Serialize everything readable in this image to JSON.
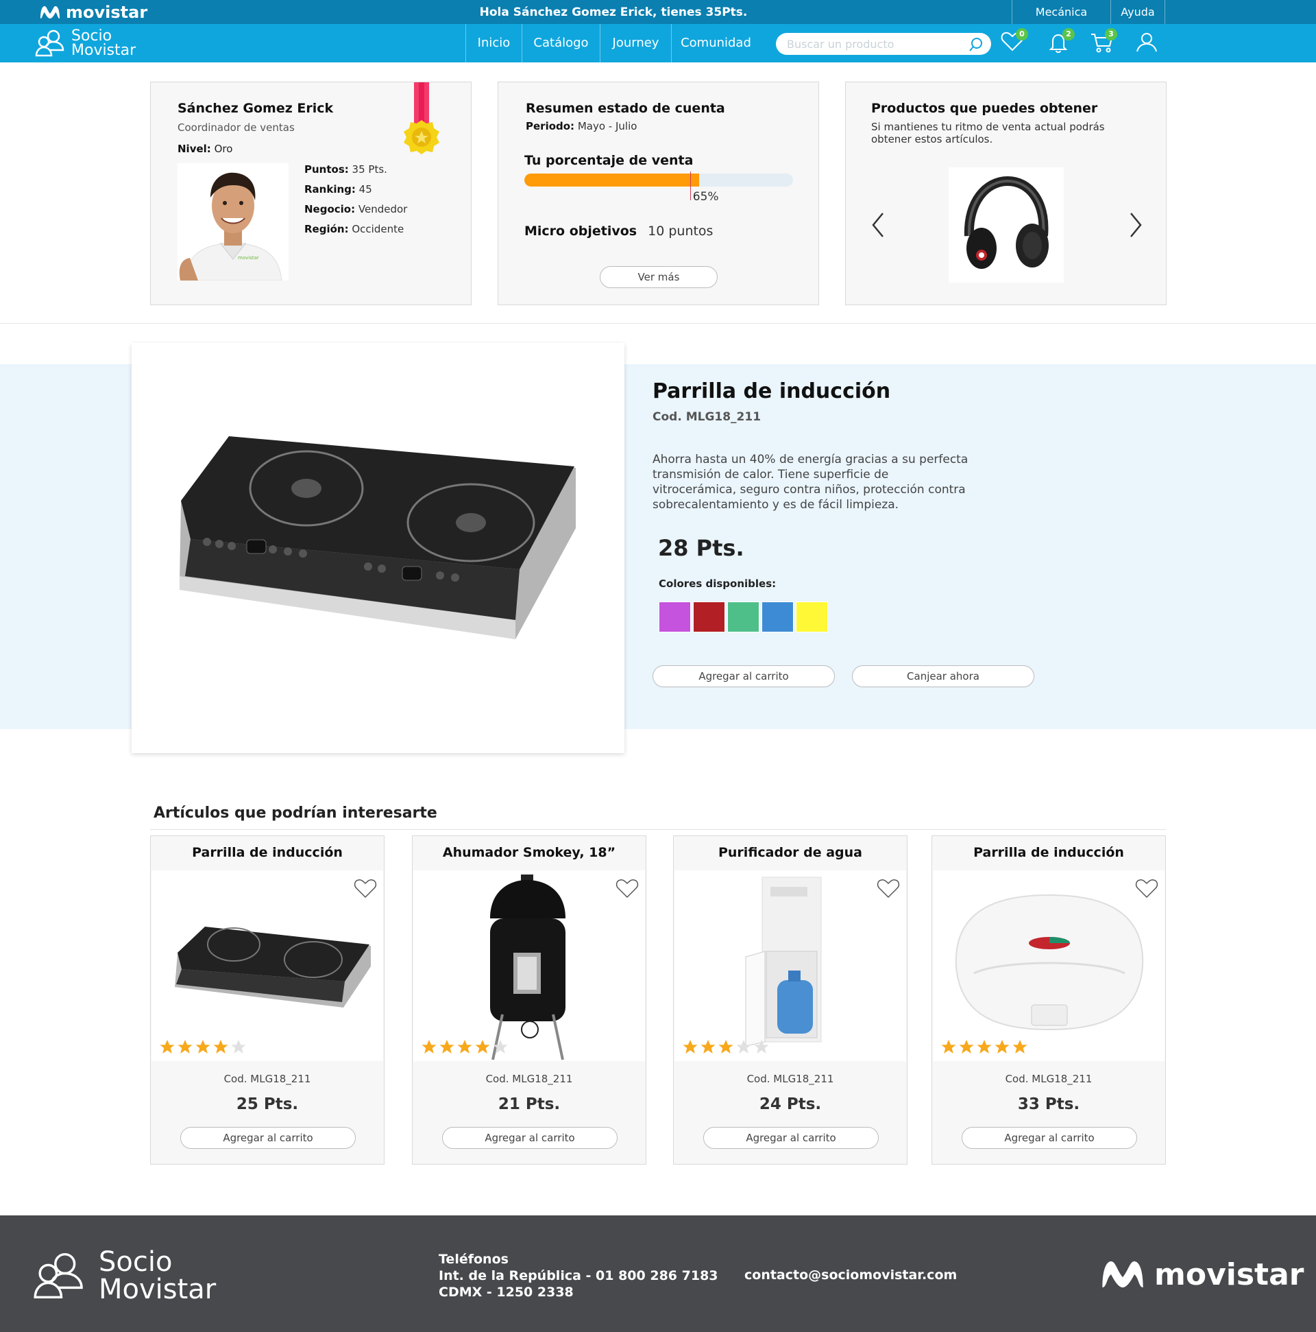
{
  "topbar": {
    "brand": "movistar",
    "greeting": "Hola Sánchez Gomez Erick, tienes 35Pts.",
    "links": [
      "Mecánica",
      "Ayuda"
    ]
  },
  "nav": {
    "brand_line1": "Socio",
    "brand_line2": "Movistar",
    "items": [
      "Inicio",
      "Catálogo",
      "Journey",
      "Comunidad"
    ],
    "search_placeholder": "Buscar un producto",
    "badges": {
      "favorites": "0",
      "notifications": "2",
      "cart": "3"
    }
  },
  "profile": {
    "name": "Sánchez Gomez Erick",
    "role": "Coordinador de ventas",
    "level_label": "Nivel:",
    "level": "Oro",
    "points_label": "Puntos:",
    "points": "35 Pts.",
    "ranking_label": "Ranking:",
    "ranking": "45",
    "business_label": "Negocio:",
    "business": "Vendedor",
    "region_label": "Región:",
    "region": "Occidente"
  },
  "summary": {
    "title": "Resumen estado de cuenta",
    "period_label": "Periodo:",
    "period": "Mayo - Julio",
    "percent_label": "Tu porcentaje de venta",
    "percent_value": "65%",
    "percent": 65,
    "micro_label": "Micro objetivos",
    "micro_value": "10 puntos",
    "more_button": "Ver más"
  },
  "obtainable": {
    "title": "Productos que puedes obtener",
    "subtitle": "Si mantienes tu ritmo de venta actual podrás obtener estos artículos."
  },
  "product": {
    "title": "Parrilla de inducción",
    "code": "Cod. MLG18_211",
    "description": "Ahorra hasta un 40% de energía gracias a su perfecta transmisión de calor. Tiene superficie de vitrocerámica, seguro contra niños, protección contra sobrecalentamiento y es de fácil limpieza.",
    "price": "28 Pts.",
    "colors_label": "Colores disponibles:",
    "colors": [
      "#c553dd",
      "#b22025",
      "#4fbf8a",
      "#3e8bd5",
      "#fff836"
    ],
    "add_to_cart": "Agregar al carrito",
    "redeem": "Canjear ahora"
  },
  "related": {
    "title": "Artículos que podrían interesarte",
    "items": [
      {
        "title": "Parrilla de inducción",
        "code": "Cod. MLG18_211",
        "price": "25 Pts.",
        "rating": 4,
        "button": "Agregar al carrito"
      },
      {
        "title": "Ahumador Smokey, 18”",
        "code": "Cod. MLG18_211",
        "price": "21 Pts.",
        "rating": 4,
        "button": "Agregar al carrito"
      },
      {
        "title": "Purificador de agua",
        "code": "Cod. MLG18_211",
        "price": "24 Pts.",
        "rating": 3,
        "button": "Agregar al carrito"
      },
      {
        "title": "Parrilla de inducción",
        "code": "Cod. MLG18_211",
        "price": "33 Pts.",
        "rating": 5,
        "button": "Agregar al carrito"
      }
    ]
  },
  "footer": {
    "brand_line1": "Socio",
    "brand_line2": "Movistar",
    "phones_title": "Teléfonos",
    "phone1": "Int. de la República - 01 800 286 7183",
    "phone2": "CDMX - 1250 2338",
    "email": "contacto@sociomovistar.com",
    "logo_text": "movistar"
  },
  "theme": {
    "topbar": "#0a7fb0",
    "navbar": "#0fa6dd",
    "accent_orange": "#ff9a08",
    "star": "#f7a81b",
    "badge": "#5bc44a"
  }
}
